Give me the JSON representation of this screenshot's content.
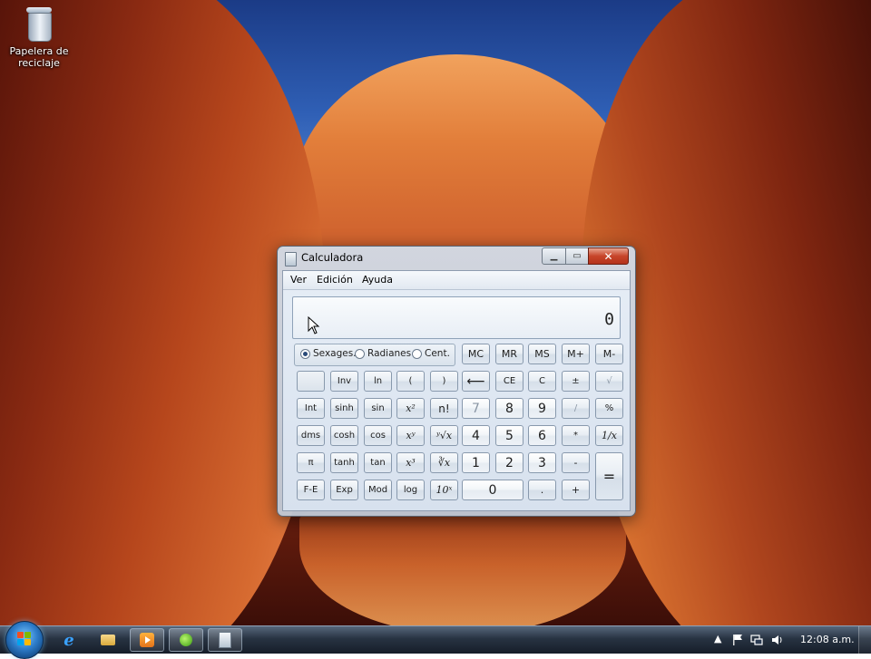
{
  "desktop": {
    "icon_label": "Papelera de reciclaje"
  },
  "window": {
    "title": "Calculadora",
    "menu": [
      "Ver",
      "Edición",
      "Ayuda"
    ],
    "display_value": "0",
    "angle_modes": [
      {
        "label": "Sexages.",
        "selected": true
      },
      {
        "label": "Radianes",
        "selected": false
      },
      {
        "label": "Cent.",
        "selected": false
      }
    ],
    "memory_buttons": [
      "MC",
      "MR",
      "MS",
      "M+",
      "M-"
    ],
    "buttons": {
      "blank": "",
      "inv": "Inv",
      "ln": "ln",
      "lparen": "(",
      "rparen": ")",
      "backspace": "⟵",
      "ce": "CE",
      "c": "C",
      "plusminus": "±",
      "sqrt": "√",
      "int": "Int",
      "sinh": "sinh",
      "sin": "sin",
      "x2": "x²",
      "nfact": "n!",
      "n7": "7",
      "n8": "8",
      "n9": "9",
      "div": "/",
      "pct": "%",
      "dms": "dms",
      "cosh": "cosh",
      "cos": "cos",
      "xy": "xʸ",
      "yroot": "ʸ√x",
      "n4": "4",
      "n5": "5",
      "n6": "6",
      "mul": "*",
      "recip": "1/x",
      "pi": "π",
      "tanh": "tanh",
      "tan": "tan",
      "x3": "x³",
      "cuberoot": "∛x",
      "n1": "1",
      "n2": "2",
      "n3": "3",
      "sub": "-",
      "eq": "=",
      "fe": "F-E",
      "exp": "Exp",
      "mod": "Mod",
      "log": "log",
      "ten_x": "10ˣ",
      "n0": "0",
      "dot": ".",
      "add": "+"
    }
  },
  "taskbar": {
    "clock": "12:08 a.m."
  }
}
